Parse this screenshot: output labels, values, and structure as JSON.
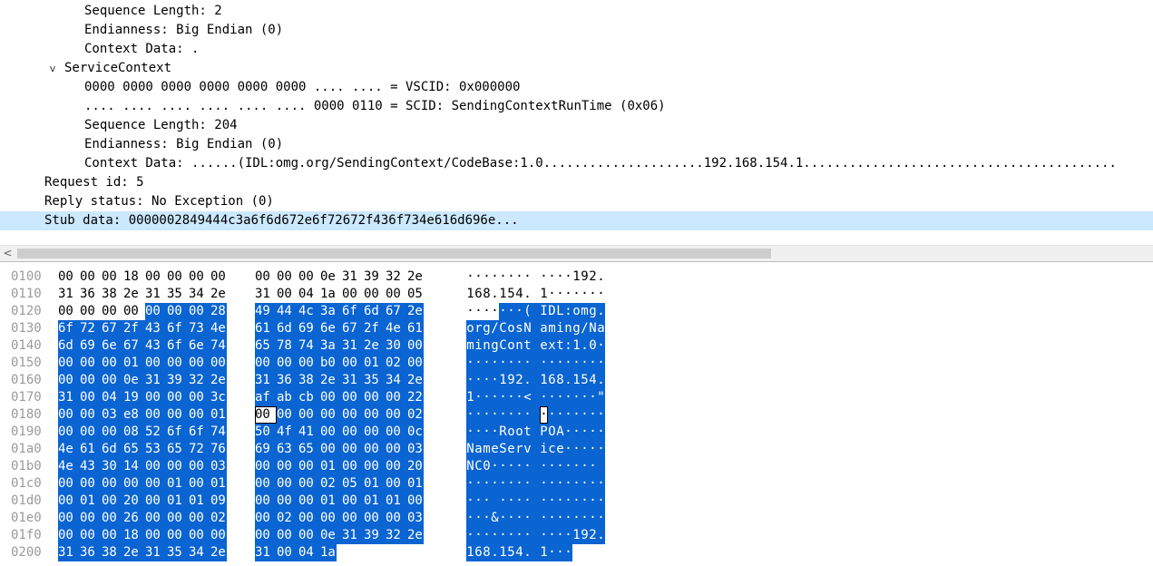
{
  "tree": {
    "lines": [
      {
        "text": "Sequence Length: 2",
        "indent": 93
      },
      {
        "text": "Endianness: Big Endian (0)",
        "indent": 93
      },
      {
        "text": "Context Data: .",
        "indent": 93
      },
      {
        "text": "ServiceContext",
        "indent": 71,
        "expander": "v"
      },
      {
        "text": "0000 0000 0000 0000 0000 0000 .... .... = VSCID: 0x000000",
        "indent": 93
      },
      {
        "text": ".... .... .... .... .... .... 0000 0110 = SCID: SendingContextRunTime (0x06)",
        "indent": 93
      },
      {
        "text": "Sequence Length: 204",
        "indent": 93
      },
      {
        "text": "Endianness: Big Endian (0)",
        "indent": 93
      },
      {
        "text": "Context Data: ......(IDL:omg.org/SendingContext/CodeBase:1.0.....................192.168.154.1.........................................",
        "indent": 93
      },
      {
        "text": "Request id: 5",
        "indent": 49
      },
      {
        "text": "Reply status: No Exception (0)",
        "indent": 49
      },
      {
        "text": "Stub data: 0000002849444c3a6f6d672e6f72672f436f734e616d696e...",
        "indent": 49,
        "selected": true
      }
    ]
  },
  "scrollbar": {
    "left_arrow": "<"
  },
  "hex": {
    "rows": [
      {
        "offset": "0100",
        "bytes": [
          "00",
          "00",
          "00",
          "18",
          "00",
          "00",
          "00",
          "00",
          "00",
          "00",
          "00",
          "0e",
          "31",
          "39",
          "32",
          "2e"
        ],
        "ascii": "········ ····192."
      },
      {
        "offset": "0110",
        "bytes": [
          "31",
          "36",
          "38",
          "2e",
          "31",
          "35",
          "34",
          "2e",
          "31",
          "00",
          "04",
          "1a",
          "00",
          "00",
          "00",
          "05"
        ],
        "ascii": "168.154. 1·······"
      },
      {
        "offset": "0120",
        "bytes": [
          "00",
          "00",
          "00",
          "00",
          "00",
          "00",
          "00",
          "28",
          "49",
          "44",
          "4c",
          "3a",
          "6f",
          "6d",
          "67",
          "2e"
        ],
        "ascii": "·······( IDL:omg."
      },
      {
        "offset": "0130",
        "bytes": [
          "6f",
          "72",
          "67",
          "2f",
          "43",
          "6f",
          "73",
          "4e",
          "61",
          "6d",
          "69",
          "6e",
          "67",
          "2f",
          "4e",
          "61"
        ],
        "ascii": "org/CosN aming/Na"
      },
      {
        "offset": "0140",
        "bytes": [
          "6d",
          "69",
          "6e",
          "67",
          "43",
          "6f",
          "6e",
          "74",
          "65",
          "78",
          "74",
          "3a",
          "31",
          "2e",
          "30",
          "00"
        ],
        "ascii": "mingCont ext:1.0·"
      },
      {
        "offset": "0150",
        "bytes": [
          "00",
          "00",
          "00",
          "01",
          "00",
          "00",
          "00",
          "00",
          "00",
          "00",
          "00",
          "b0",
          "00",
          "01",
          "02",
          "00"
        ],
        "ascii": "········ ········"
      },
      {
        "offset": "0160",
        "bytes": [
          "00",
          "00",
          "00",
          "0e",
          "31",
          "39",
          "32",
          "2e",
          "31",
          "36",
          "38",
          "2e",
          "31",
          "35",
          "34",
          "2e"
        ],
        "ascii": "····192. 168.154."
      },
      {
        "offset": "0170",
        "bytes": [
          "31",
          "00",
          "04",
          "19",
          "00",
          "00",
          "00",
          "3c",
          "af",
          "ab",
          "cb",
          "00",
          "00",
          "00",
          "00",
          "22"
        ],
        "ascii": "1······< ·······\""
      },
      {
        "offset": "0180",
        "bytes": [
          "00",
          "00",
          "03",
          "e8",
          "00",
          "00",
          "00",
          "01",
          "00",
          "00",
          "00",
          "00",
          "00",
          "00",
          "00",
          "02"
        ],
        "ascii": "········ ········"
      },
      {
        "offset": "0190",
        "bytes": [
          "00",
          "00",
          "00",
          "08",
          "52",
          "6f",
          "6f",
          "74",
          "50",
          "4f",
          "41",
          "00",
          "00",
          "00",
          "00",
          "0c"
        ],
        "ascii": "····Root POA·····"
      },
      {
        "offset": "01a0",
        "bytes": [
          "4e",
          "61",
          "6d",
          "65",
          "53",
          "65",
          "72",
          "76",
          "69",
          "63",
          "65",
          "00",
          "00",
          "00",
          "00",
          "03"
        ],
        "ascii": "NameServ ice·····"
      },
      {
        "offset": "01b0",
        "bytes": [
          "4e",
          "43",
          "30",
          "14",
          "00",
          "00",
          "00",
          "03",
          "00",
          "00",
          "00",
          "01",
          "00",
          "00",
          "00",
          "20"
        ],
        "ascii": "NC0····· ······· "
      },
      {
        "offset": "01c0",
        "bytes": [
          "00",
          "00",
          "00",
          "00",
          "00",
          "01",
          "00",
          "01",
          "00",
          "00",
          "00",
          "02",
          "05",
          "01",
          "00",
          "01"
        ],
        "ascii": "········ ········"
      },
      {
        "offset": "01d0",
        "bytes": [
          "00",
          "01",
          "00",
          "20",
          "00",
          "01",
          "01",
          "09",
          "00",
          "00",
          "00",
          "01",
          "00",
          "01",
          "01",
          "00"
        ],
        "ascii": "··· ···· ········"
      },
      {
        "offset": "01e0",
        "bytes": [
          "00",
          "00",
          "00",
          "26",
          "00",
          "00",
          "00",
          "02",
          "00",
          "02",
          "00",
          "00",
          "00",
          "00",
          "00",
          "03"
        ],
        "ascii": "···&···· ········"
      },
      {
        "offset": "01f0",
        "bytes": [
          "00",
          "00",
          "00",
          "18",
          "00",
          "00",
          "00",
          "00",
          "00",
          "00",
          "00",
          "0e",
          "31",
          "39",
          "32",
          "2e"
        ],
        "ascii": "········ ····192."
      },
      {
        "offset": "0200",
        "bytes": [
          "31",
          "36",
          "38",
          "2e",
          "31",
          "35",
          "34",
          "2e",
          "31",
          "00",
          "04",
          "1a"
        ],
        "ascii": "168.154. 1···"
      }
    ],
    "selection_start": {
      "row": 2,
      "byte": 4
    },
    "cursor": {
      "row": 8,
      "byte": 8
    }
  }
}
